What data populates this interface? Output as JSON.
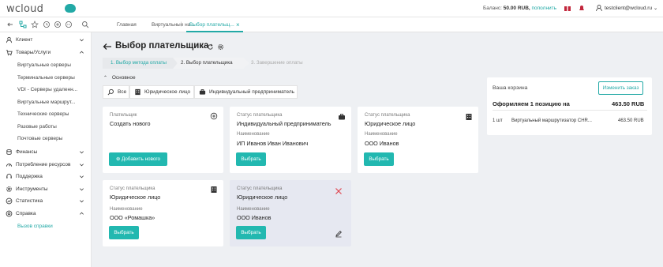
{
  "header": {
    "logo": "wcloud",
    "balance_label": "Баланс:",
    "balance_value": "50.00 RUB,",
    "balance_link": "пополнить",
    "user": "testclient@wcloud.ru"
  },
  "tabs": [
    {
      "label": "Главная"
    },
    {
      "label": "Виртуальные на..."
    },
    {
      "label": "Выбор плательщ..."
    }
  ],
  "sidebar": {
    "items": [
      {
        "label": "Клиент",
        "icon": "user-icon"
      },
      {
        "label": "Товары/Услуги",
        "icon": "cart-icon"
      },
      {
        "label": "Финансы",
        "icon": "coins-icon"
      },
      {
        "label": "Потребление ресурсов",
        "icon": "gauge-icon"
      },
      {
        "label": "Поддержка",
        "icon": "support-icon"
      },
      {
        "label": "Инструменты",
        "icon": "gear-icon"
      },
      {
        "label": "Статистика",
        "icon": "chart-icon"
      },
      {
        "label": "Справка",
        "icon": "help-icon"
      }
    ],
    "sub_items": [
      "Виртуальные серверы",
      "Терминальные серверы",
      "VDI - Серверы удаленн...",
      "Виртуальные маршрут...",
      "Технические серверы",
      "Разовые работы",
      "Почтовые серверы"
    ],
    "help_sub": "Вызов справки"
  },
  "page": {
    "title": "Выбор плательщика",
    "steps": [
      "1. Выбор метода оплаты",
      "2. Выбор плательщика",
      "3. Завершение оплаты"
    ],
    "section": "Основное",
    "filters": [
      "Все",
      "Юридическое лицо",
      "Индивидуальный предприниматель"
    ]
  },
  "cards": {
    "new": {
      "label": "Плательщик",
      "value": "Создать нового",
      "button": "Добавить нового"
    },
    "status_label": "Статус плательщика",
    "name_label": "Наименование",
    "choose": "Выбрать",
    "list": [
      {
        "status": "Индивидуальный предприниматель",
        "name": "ИП Иванов Иван Иванович"
      },
      {
        "status": "Юридическое лицо",
        "name": "ООО Иванов"
      },
      {
        "status": "Юридическое лицо",
        "name": "ООО «Ромашка»"
      },
      {
        "status": "Юридическое лицо",
        "name": "ООО Иванов"
      }
    ]
  },
  "cart": {
    "title": "Ваша корзина",
    "change_button": "Изменить заказ",
    "summary": "Оформляем 1 позицию на",
    "total": "463.50 RUB",
    "qty": "1 шт",
    "item": "Виртуальный маршрутизатор CHR...",
    "price": "463.50 RUB"
  },
  "colors": {
    "accent": "#22a9a6",
    "button": "#22b8b0",
    "danger": "#e0454f"
  }
}
